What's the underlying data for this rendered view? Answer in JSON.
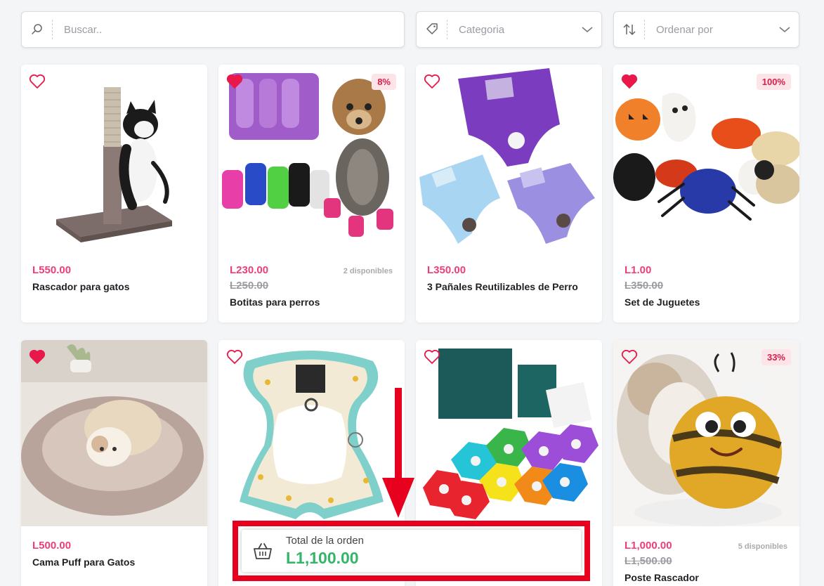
{
  "filters": {
    "search": {
      "placeholder": "Buscar.."
    },
    "category": {
      "placeholder": "Categoria"
    },
    "sort": {
      "placeholder": "Ordenar por"
    }
  },
  "products": [
    {
      "name": "Rascador para gatos",
      "price": "L550.00",
      "favorite": false
    },
    {
      "name": "Botitas para perros",
      "price": "L230.00",
      "old_price": "L250.00",
      "badge": "8%",
      "available": "2 disponibles",
      "favorite": true
    },
    {
      "name": "3 Pañales Reutilizables de Perro",
      "price": "L350.00",
      "favorite": false
    },
    {
      "name": "Set de Juguetes",
      "price": "L1.00",
      "old_price": "L350.00",
      "badge": "100%",
      "favorite": true
    },
    {
      "name": "Cama Puff para Gatos",
      "price": "L500.00",
      "favorite": true
    },
    {
      "favorite": false
    },
    {
      "favorite": false
    },
    {
      "name": "Poste Rascador",
      "price": "L1,000.00",
      "old_price": "L1,500.00",
      "badge": "33%",
      "available": "5 disponibles",
      "favorite": false
    }
  ],
  "order": {
    "label": "Total de la orden",
    "total": "L1,100.00"
  },
  "colors": {
    "price": "#ef3c7b",
    "heart": "#e8194a",
    "total": "#34b56a",
    "highlight": "#e8001f"
  }
}
